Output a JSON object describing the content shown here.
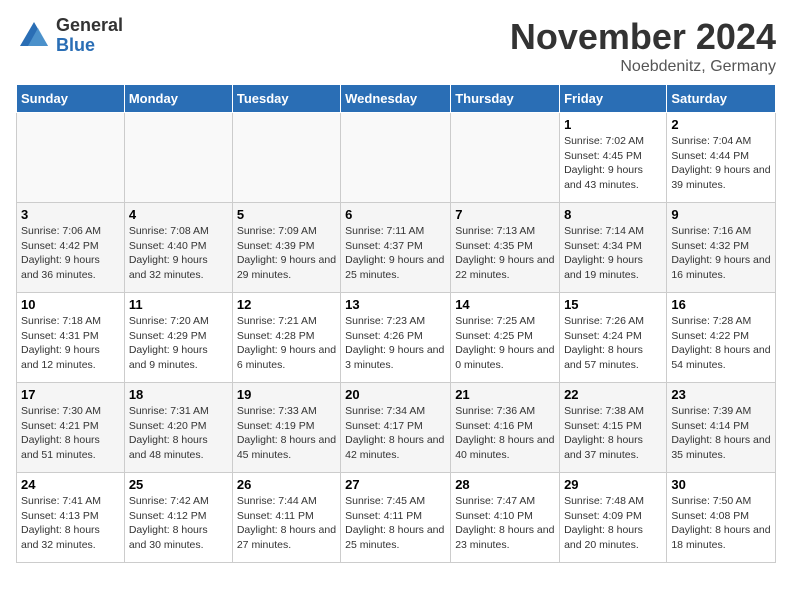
{
  "logo": {
    "general": "General",
    "blue": "Blue"
  },
  "title": "November 2024",
  "location": "Noebdenitz, Germany",
  "days_of_week": [
    "Sunday",
    "Monday",
    "Tuesday",
    "Wednesday",
    "Thursday",
    "Friday",
    "Saturday"
  ],
  "weeks": [
    [
      {
        "day": "",
        "info": ""
      },
      {
        "day": "",
        "info": ""
      },
      {
        "day": "",
        "info": ""
      },
      {
        "day": "",
        "info": ""
      },
      {
        "day": "",
        "info": ""
      },
      {
        "day": "1",
        "info": "Sunrise: 7:02 AM\nSunset: 4:45 PM\nDaylight: 9 hours and 43 minutes."
      },
      {
        "day": "2",
        "info": "Sunrise: 7:04 AM\nSunset: 4:44 PM\nDaylight: 9 hours and 39 minutes."
      }
    ],
    [
      {
        "day": "3",
        "info": "Sunrise: 7:06 AM\nSunset: 4:42 PM\nDaylight: 9 hours and 36 minutes."
      },
      {
        "day": "4",
        "info": "Sunrise: 7:08 AM\nSunset: 4:40 PM\nDaylight: 9 hours and 32 minutes."
      },
      {
        "day": "5",
        "info": "Sunrise: 7:09 AM\nSunset: 4:39 PM\nDaylight: 9 hours and 29 minutes."
      },
      {
        "day": "6",
        "info": "Sunrise: 7:11 AM\nSunset: 4:37 PM\nDaylight: 9 hours and 25 minutes."
      },
      {
        "day": "7",
        "info": "Sunrise: 7:13 AM\nSunset: 4:35 PM\nDaylight: 9 hours and 22 minutes."
      },
      {
        "day": "8",
        "info": "Sunrise: 7:14 AM\nSunset: 4:34 PM\nDaylight: 9 hours and 19 minutes."
      },
      {
        "day": "9",
        "info": "Sunrise: 7:16 AM\nSunset: 4:32 PM\nDaylight: 9 hours and 16 minutes."
      }
    ],
    [
      {
        "day": "10",
        "info": "Sunrise: 7:18 AM\nSunset: 4:31 PM\nDaylight: 9 hours and 12 minutes."
      },
      {
        "day": "11",
        "info": "Sunrise: 7:20 AM\nSunset: 4:29 PM\nDaylight: 9 hours and 9 minutes."
      },
      {
        "day": "12",
        "info": "Sunrise: 7:21 AM\nSunset: 4:28 PM\nDaylight: 9 hours and 6 minutes."
      },
      {
        "day": "13",
        "info": "Sunrise: 7:23 AM\nSunset: 4:26 PM\nDaylight: 9 hours and 3 minutes."
      },
      {
        "day": "14",
        "info": "Sunrise: 7:25 AM\nSunset: 4:25 PM\nDaylight: 9 hours and 0 minutes."
      },
      {
        "day": "15",
        "info": "Sunrise: 7:26 AM\nSunset: 4:24 PM\nDaylight: 8 hours and 57 minutes."
      },
      {
        "day": "16",
        "info": "Sunrise: 7:28 AM\nSunset: 4:22 PM\nDaylight: 8 hours and 54 minutes."
      }
    ],
    [
      {
        "day": "17",
        "info": "Sunrise: 7:30 AM\nSunset: 4:21 PM\nDaylight: 8 hours and 51 minutes."
      },
      {
        "day": "18",
        "info": "Sunrise: 7:31 AM\nSunset: 4:20 PM\nDaylight: 8 hours and 48 minutes."
      },
      {
        "day": "19",
        "info": "Sunrise: 7:33 AM\nSunset: 4:19 PM\nDaylight: 8 hours and 45 minutes."
      },
      {
        "day": "20",
        "info": "Sunrise: 7:34 AM\nSunset: 4:17 PM\nDaylight: 8 hours and 42 minutes."
      },
      {
        "day": "21",
        "info": "Sunrise: 7:36 AM\nSunset: 4:16 PM\nDaylight: 8 hours and 40 minutes."
      },
      {
        "day": "22",
        "info": "Sunrise: 7:38 AM\nSunset: 4:15 PM\nDaylight: 8 hours and 37 minutes."
      },
      {
        "day": "23",
        "info": "Sunrise: 7:39 AM\nSunset: 4:14 PM\nDaylight: 8 hours and 35 minutes."
      }
    ],
    [
      {
        "day": "24",
        "info": "Sunrise: 7:41 AM\nSunset: 4:13 PM\nDaylight: 8 hours and 32 minutes."
      },
      {
        "day": "25",
        "info": "Sunrise: 7:42 AM\nSunset: 4:12 PM\nDaylight: 8 hours and 30 minutes."
      },
      {
        "day": "26",
        "info": "Sunrise: 7:44 AM\nSunset: 4:11 PM\nDaylight: 8 hours and 27 minutes."
      },
      {
        "day": "27",
        "info": "Sunrise: 7:45 AM\nSunset: 4:11 PM\nDaylight: 8 hours and 25 minutes."
      },
      {
        "day": "28",
        "info": "Sunrise: 7:47 AM\nSunset: 4:10 PM\nDaylight: 8 hours and 23 minutes."
      },
      {
        "day": "29",
        "info": "Sunrise: 7:48 AM\nSunset: 4:09 PM\nDaylight: 8 hours and 20 minutes."
      },
      {
        "day": "30",
        "info": "Sunrise: 7:50 AM\nSunset: 4:08 PM\nDaylight: 8 hours and 18 minutes."
      }
    ]
  ]
}
